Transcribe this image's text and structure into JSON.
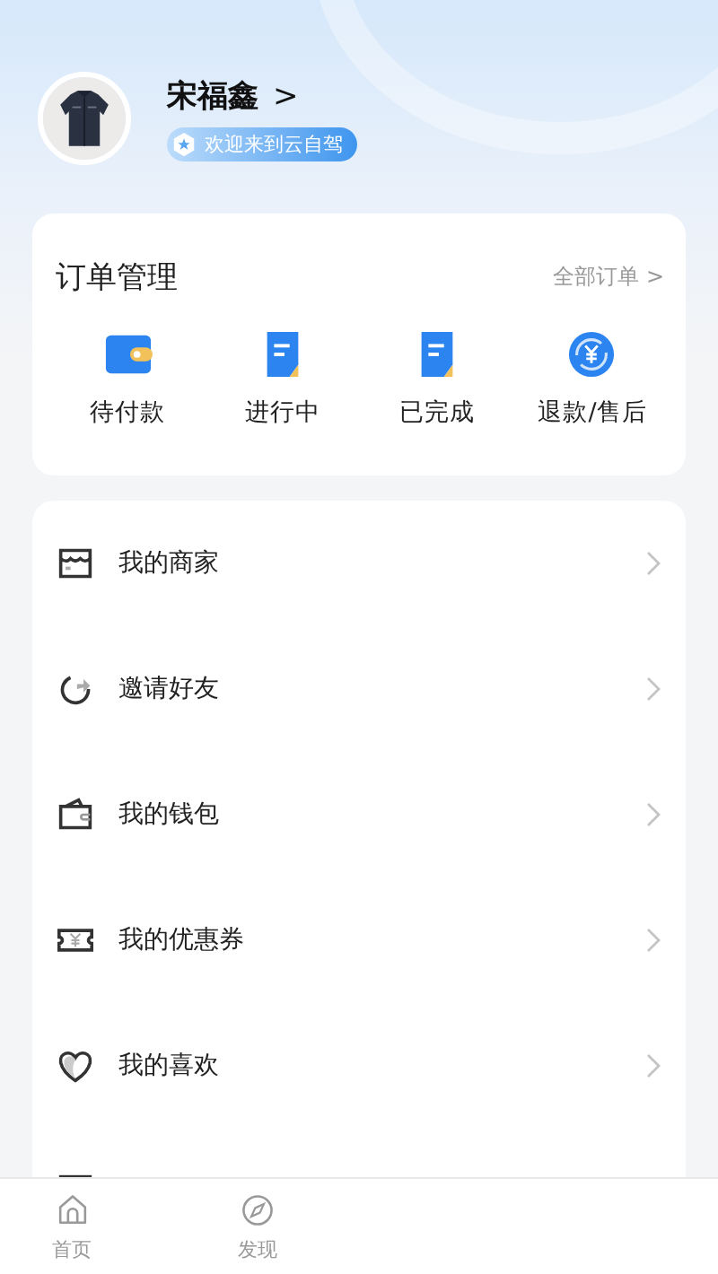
{
  "profile": {
    "name": "宋福鑫",
    "name_chevron": ">",
    "badge": "欢迎来到云自驾"
  },
  "orders": {
    "title": "订单管理",
    "all_link": "全部订单 >",
    "items": [
      {
        "label": "待付款",
        "kind": "wallet"
      },
      {
        "label": "进行中",
        "kind": "doc"
      },
      {
        "label": "已完成",
        "kind": "doc"
      },
      {
        "label": "退款/售后",
        "kind": "refund"
      }
    ]
  },
  "menu": [
    {
      "label": "我的商家",
      "kind": "shop"
    },
    {
      "label": "邀请好友",
      "kind": "invite"
    },
    {
      "label": "我的钱包",
      "kind": "wallet"
    },
    {
      "label": "我的优惠券",
      "kind": "coupon"
    },
    {
      "label": "我的喜欢",
      "kind": "heart"
    }
  ],
  "tab_bar": [
    {
      "label": "首页",
      "kind": "home",
      "selected": false
    },
    {
      "label": "发现",
      "kind": "discover",
      "selected": false
    }
  ]
}
